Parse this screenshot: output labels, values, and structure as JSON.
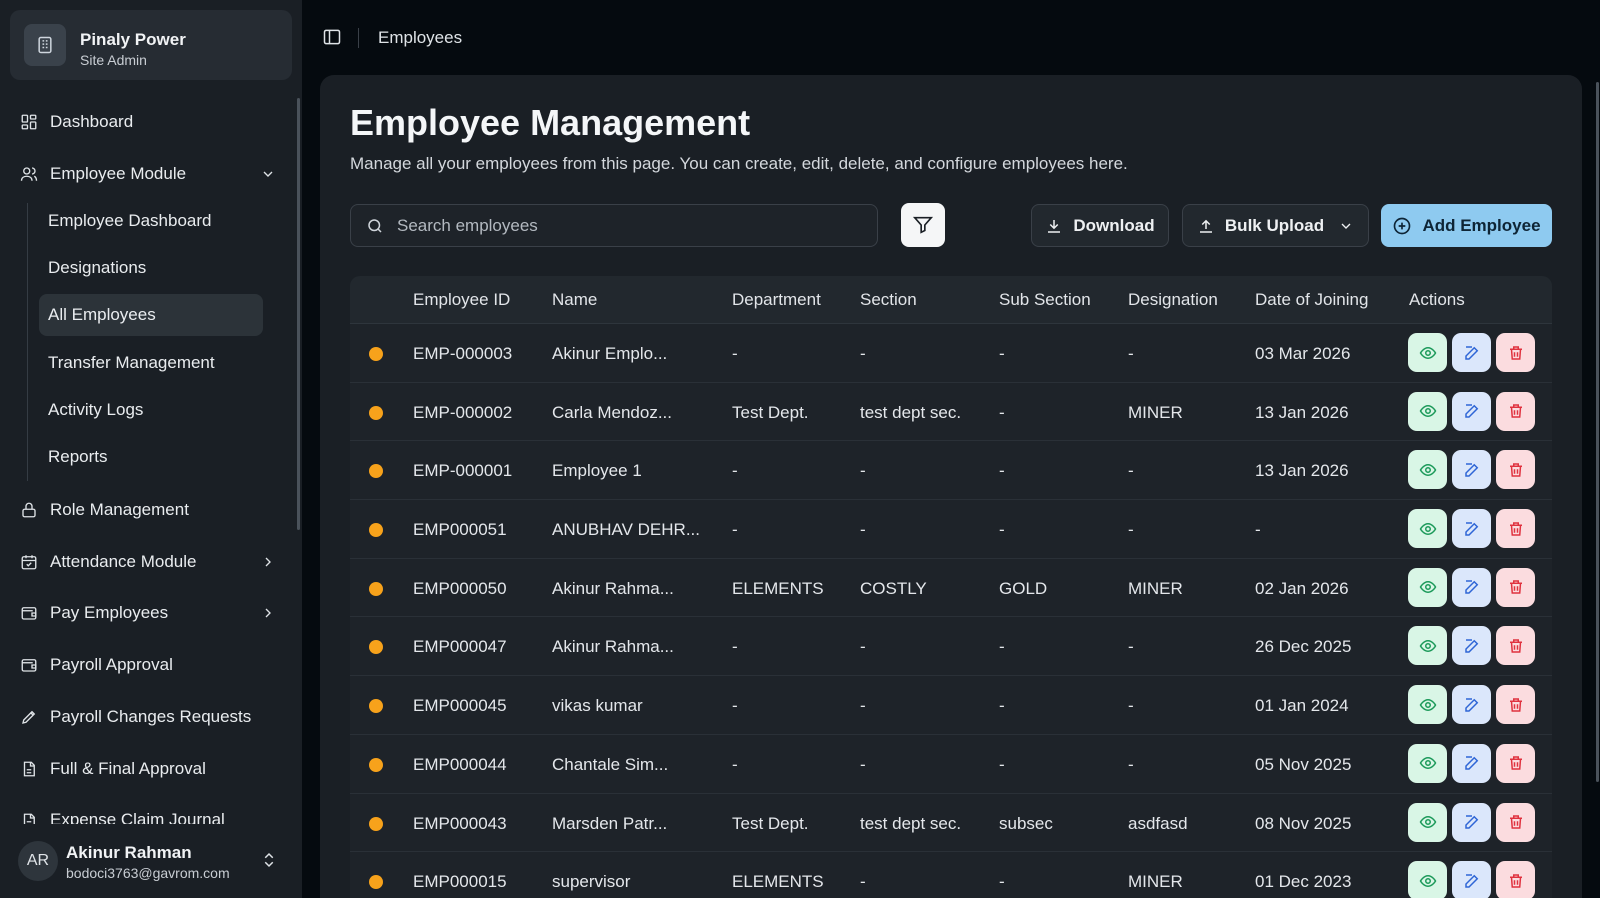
{
  "org": {
    "name": "Pinaly Power",
    "role": "Site Admin"
  },
  "breadcrumb": "Employees",
  "sidebar": {
    "items": [
      {
        "label": "Dashboard",
        "icon": "dashboard-grid-icon"
      },
      {
        "label": "Employee Module",
        "icon": "users-icon"
      },
      {
        "label": "Role Management",
        "icon": "lock-icon"
      },
      {
        "label": "Attendance Module",
        "icon": "calendar-check-icon"
      },
      {
        "label": "Pay Employees",
        "icon": "wallet-icon"
      },
      {
        "label": "Payroll Approval",
        "icon": "wallet-icon"
      },
      {
        "label": "Payroll Changes Requests",
        "icon": "pencil-icon"
      },
      {
        "label": "Full & Final Approval",
        "icon": "file-icon"
      },
      {
        "label": "Expense Claim Journal",
        "icon": "file-icon"
      }
    ],
    "sub_items": [
      "Employee Dashboard",
      "Designations",
      "All Employees",
      "Transfer Management",
      "Activity Logs",
      "Reports"
    ]
  },
  "user": {
    "initials": "AR",
    "name": "Akinur Rahman",
    "email": "bodoci3763@gavrom.com"
  },
  "page": {
    "title": "Employee Management",
    "description": "Manage all your employees from this page. You can create, edit, delete, and configure employees here."
  },
  "toolbar": {
    "search_placeholder": "Search employees",
    "download_label": "Download",
    "bulk_upload_label": "Bulk Upload",
    "add_employee_label": "Add Employee",
    "accent_color": "#8ecaf0"
  },
  "table": {
    "headers": [
      "Employee ID",
      "Name",
      "Department",
      "Section",
      "Sub Section",
      "Designation",
      "Date of Joining",
      "Actions"
    ],
    "status_color": "#f7a21b",
    "rows": [
      [
        "EMP-000003",
        "Akinur Emplo...",
        "-",
        "-",
        "-",
        "-",
        "03 Mar 2026"
      ],
      [
        "EMP-000002",
        "Carla Mendoz...",
        "Test Dept.",
        "test dept sec.",
        "-",
        "MINER",
        "13 Jan 2026"
      ],
      [
        "EMP-000001",
        "Employee 1",
        "-",
        "-",
        "-",
        "-",
        "13 Jan 2026"
      ],
      [
        "EMP000051",
        "ANUBHAV DEHR...",
        "-",
        "-",
        "-",
        "-",
        "-"
      ],
      [
        "EMP000050",
        "Akinur Rahma...",
        "ELEMENTS",
        "COSTLY",
        "GOLD",
        "MINER",
        "02 Jan 2026"
      ],
      [
        "EMP000047",
        "Akinur Rahma...",
        "-",
        "-",
        "-",
        "-",
        "26 Dec 2025"
      ],
      [
        "EMP000045",
        "vikas kumar",
        "-",
        "-",
        "-",
        "-",
        "01 Jan 2024"
      ],
      [
        "EMP000044",
        "Chantale Sim...",
        "-",
        "-",
        "-",
        "-",
        "05 Nov 2025"
      ],
      [
        "EMP000043",
        "Marsden Patr...",
        "Test Dept.",
        "test dept sec.",
        "subsec",
        "asdfasd",
        "08 Nov 2025"
      ],
      [
        "EMP000015",
        "supervisor",
        "ELEMENTS",
        "-",
        "-",
        "MINER",
        "01 Dec 2023"
      ]
    ]
  }
}
